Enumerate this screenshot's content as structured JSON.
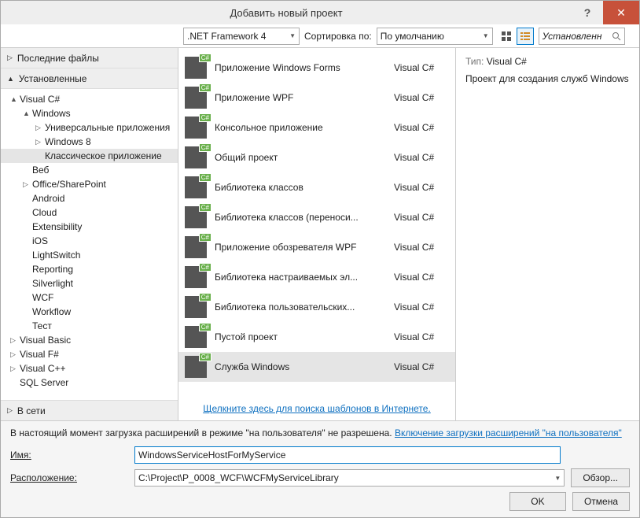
{
  "title": "Добавить новый проект",
  "toolbar": {
    "framework": ".NET Framework 4",
    "sort_label": "Сортировка по:",
    "sort_value": "По умолчанию",
    "search_placeholder": "Установленн"
  },
  "sections": {
    "recent": "Последние файлы",
    "installed": "Установленные",
    "online": "В сети"
  },
  "tree": [
    {
      "label": "Visual C#",
      "lvl": 1,
      "exp": "▲"
    },
    {
      "label": "Windows",
      "lvl": 2,
      "exp": "▲"
    },
    {
      "label": "Универсальные приложения",
      "lvl": 3,
      "exp": "▷"
    },
    {
      "label": "Windows 8",
      "lvl": 3,
      "exp": "▷"
    },
    {
      "label": "Классическое приложение",
      "lvl": 3,
      "exp": "",
      "selected": true
    },
    {
      "label": "Веб",
      "lvl": 2,
      "exp": ""
    },
    {
      "label": "Office/SharePoint",
      "lvl": 2,
      "exp": "▷"
    },
    {
      "label": "Android",
      "lvl": 2,
      "exp": ""
    },
    {
      "label": "Cloud",
      "lvl": 2,
      "exp": ""
    },
    {
      "label": "Extensibility",
      "lvl": 2,
      "exp": ""
    },
    {
      "label": "iOS",
      "lvl": 2,
      "exp": ""
    },
    {
      "label": "LightSwitch",
      "lvl": 2,
      "exp": ""
    },
    {
      "label": "Reporting",
      "lvl": 2,
      "exp": ""
    },
    {
      "label": "Silverlight",
      "lvl": 2,
      "exp": ""
    },
    {
      "label": "WCF",
      "lvl": 2,
      "exp": ""
    },
    {
      "label": "Workflow",
      "lvl": 2,
      "exp": ""
    },
    {
      "label": "Тест",
      "lvl": 2,
      "exp": ""
    },
    {
      "label": "Visual Basic",
      "lvl": 1,
      "exp": "▷"
    },
    {
      "label": "Visual F#",
      "lvl": 1,
      "exp": "▷"
    },
    {
      "label": "Visual C++",
      "lvl": 1,
      "exp": "▷"
    },
    {
      "label": "SQL Server",
      "lvl": 1,
      "exp": ""
    }
  ],
  "templates": [
    {
      "name": "Приложение Windows Forms",
      "lang": "Visual C#"
    },
    {
      "name": "Приложение WPF",
      "lang": "Visual C#"
    },
    {
      "name": "Консольное приложение",
      "lang": "Visual C#"
    },
    {
      "name": "Общий проект",
      "lang": "Visual C#"
    },
    {
      "name": "Библиотека классов",
      "lang": "Visual C#"
    },
    {
      "name": "Библиотека классов (переноси...",
      "lang": "Visual C#"
    },
    {
      "name": "Приложение обозревателя WPF",
      "lang": "Visual C#"
    },
    {
      "name": "Библиотека настраиваемых эл...",
      "lang": "Visual C#"
    },
    {
      "name": "Библиотека пользовательских...",
      "lang": "Visual C#"
    },
    {
      "name": "Пустой проект",
      "lang": "Visual C#"
    },
    {
      "name": "Служба Windows",
      "lang": "Visual C#",
      "selected": true
    }
  ],
  "online_link": "Щелкните здесь для поиска шаблонов в Интернете.",
  "details": {
    "type_label": "Тип:",
    "type_value": "Visual C#",
    "description": "Проект для создания служб Windows"
  },
  "bottom": {
    "warning_text": "В настоящий момент загрузка расширений в режиме \"на пользователя\" не разрешена. ",
    "warning_link": "Включение загрузки расширений \"на пользователя\"",
    "name_label": "Имя:",
    "name_value": "WindowsServiceHostForMyService",
    "location_label": "Расположение:",
    "location_value": "C:\\Project\\P_0008_WCF\\WCFMyServiceLibrary",
    "browse": "Обзор...",
    "ok": "OK",
    "cancel": "Отмена"
  }
}
